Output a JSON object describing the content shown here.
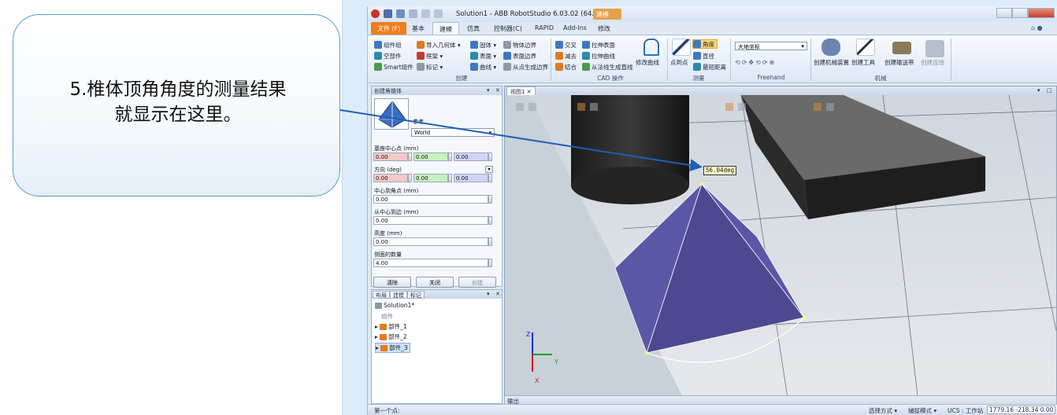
{
  "callout": {
    "line1": "5.椎体顶角角度的测量结果",
    "line2": "就显示在这里。"
  },
  "window": {
    "title": "Solution1 - ABB RobotStudio 6.03.02 (64...",
    "context_tab": "建模"
  },
  "tabs": [
    "文件 (F)",
    "基本",
    "建模",
    "仿真",
    "控制器(C)",
    "RAPID",
    "Add-Ins",
    "修改"
  ],
  "ribbon": {
    "create": {
      "label": "创建",
      "col1": [
        "组件组",
        "空部件",
        "Smart组件"
      ],
      "col2": [
        "导入几何体 ▾",
        "框架 ▾",
        "标记 ▾"
      ],
      "col3": [
        "固体 ▾",
        "表面 ▾",
        "曲线 ▾"
      ],
      "col4": [
        "物体边界",
        "表面边界",
        "从点生成边界"
      ]
    },
    "cad": {
      "label": "CAD 操作",
      "col1": [
        "交叉",
        "减去",
        "结合"
      ],
      "col2": [
        "拉伸表面",
        "拉伸曲线",
        "从法线生成直线"
      ],
      "modify_curve": "修改曲线"
    },
    "measure": {
      "label": "测量",
      "point_to_point": "点到点",
      "items": [
        "角度",
        "直径",
        "最短距离"
      ]
    },
    "freehand": {
      "label": "Freehand",
      "coord_select": "大地坐标"
    },
    "mechanism": {
      "label": "机械",
      "items": [
        "创建机械装置",
        "创建工具",
        "创建输送带",
        "创建连接"
      ]
    }
  },
  "cone_panel": {
    "title": "创建角锥体",
    "ref_label": "参考",
    "ref_value": "World",
    "base_center_label": "基座中心点 (mm)",
    "base_center": [
      "0.00",
      "0.00",
      "0.00"
    ],
    "orientation_label": "方向 (deg)",
    "orientation": [
      "0.00",
      "0.00",
      "0.00"
    ],
    "center_to_corner_label": "中心到角点 (mm)",
    "center_to_corner": "0.00",
    "center_to_edge_label": "从中心到边 (mm)",
    "center_to_edge": "0.00",
    "height_label": "高度 (mm)",
    "height": "0.00",
    "sides_label": "侧面的数量",
    "sides": "4.00",
    "buttons": [
      "清除",
      "关闭",
      "创建"
    ]
  },
  "tree_panel": {
    "tabs": [
      "布局",
      "建模",
      "标记"
    ],
    "root": "Solution1*",
    "group": "组件",
    "parts": [
      "部件_1",
      "部件_2",
      "部件_3"
    ]
  },
  "view": {
    "tab": "视图1",
    "measure_value": "56.04deg",
    "axis_labels": [
      "Z",
      "Y",
      "X"
    ]
  },
  "output": {
    "label": "输出"
  },
  "status": {
    "left": "第一个点:",
    "select_mode": "选择方式 ▾",
    "snap_mode": "捕捉模式 ▾",
    "ucs": "UCS : 工作站",
    "coords": "1779.16 -218.34 0.00"
  },
  "colors": {
    "accent": "#f07c1c",
    "callout_border": "#4aa0d8",
    "pyramid": "#4f4c96",
    "arrow": "#1f5fb8"
  }
}
